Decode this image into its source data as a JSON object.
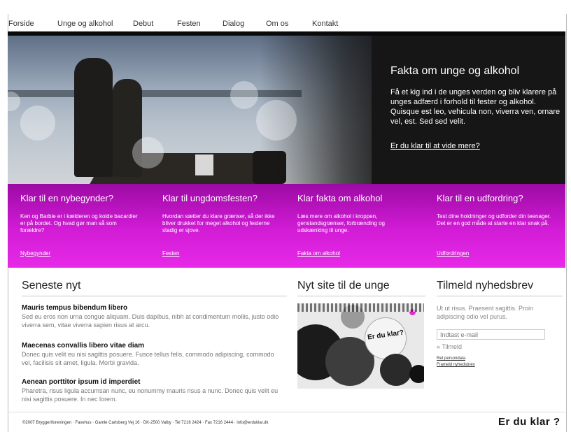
{
  "nav": [
    "Forside",
    "Unge og alkohol",
    "Debut",
    "Festen",
    "Dialog",
    "Om os",
    "Kontakt"
  ],
  "hero": {
    "title": "Fakta om unge og alkohol",
    "text": "Få et kig ind i de unges verden og bliv klarere på unges adfærd i forhold til fester og alkohol. Quisque est leo, vehicula non, viverra ven, ornare vel, est. Sed sed velit.",
    "link": "Er du klar til at vide mere?"
  },
  "columns": [
    {
      "title": "Klar til en nybegynder?",
      "text": "Ken og Barbie er i kælderen og kolde bacardier er på bordet. Og hvad gør man så som forældre?",
      "link": "Nybegynder"
    },
    {
      "title": "Klar til ungdomsfesten?",
      "text": "Hvordan sætter du klare grænser, så der ikke bliver drukket for meget alkohol og festerne stadig er sjove.",
      "link": "Festen"
    },
    {
      "title": "Klar fakta om alkohol",
      "text": "Læs mere om alkohol i kroppen, genstandsgrænser, forbrænding og udskænking til unge.",
      "link": "Fakta om alkohol"
    },
    {
      "title": "Klar til en udfordring?",
      "text": "Test dine holdninger og udforder din teenager. Det er en god måde at starte en klar snak på.",
      "link": "Udfordringen"
    }
  ],
  "news": {
    "heading": "Seneste nyt",
    "items": [
      {
        "title": "Mauris tempus bibendum libero",
        "text": "Sed eu eros non urna congue aliquam. Duis dapibus, nibh at condimentum mollis, justo odio viverra sem, vitae viverra sapien risus at arcu."
      },
      {
        "title": "Maecenas convallis libero vitae diam",
        "text": "Donec quis velit eu nisi sagittis posuere. Fusce tellus felis, commodo adipiscing, commodo vel, facilisis sit amet, ligula. Morbi gravida."
      },
      {
        "title": "Aenean porttitor ipsum id imperdiet",
        "text": "Pharetra, risus ligula accumsan nunc, eu nonummy mauris risus a nunc. Donec quis velit eu nisi sagittis posuere. In nec lorem."
      }
    ]
  },
  "site": {
    "heading": "Nyt site til de unge",
    "collage_title": "Er du klar?"
  },
  "newsletter": {
    "heading": "Tilmeld nyhedsbrev",
    "text": "Ut ut risus. Praesent sagittis. Proin adipiscing odio vel purus.",
    "placeholder": "Indtast e-mail",
    "button": "» Tilmeld",
    "link1": "Ret persondata",
    "link2": "Frameld nyhedsbrev"
  },
  "footer": {
    "text": "©2007 Bryggeriforeningen · Faxehus · Gamle Carlsberg Vej 16 · DK-2500 Valby · Tel 7216 2424 · Fax 7216 2444 · info@erduklar.dk",
    "logo_a": "Er du",
    "logo_b": "klar ?"
  }
}
